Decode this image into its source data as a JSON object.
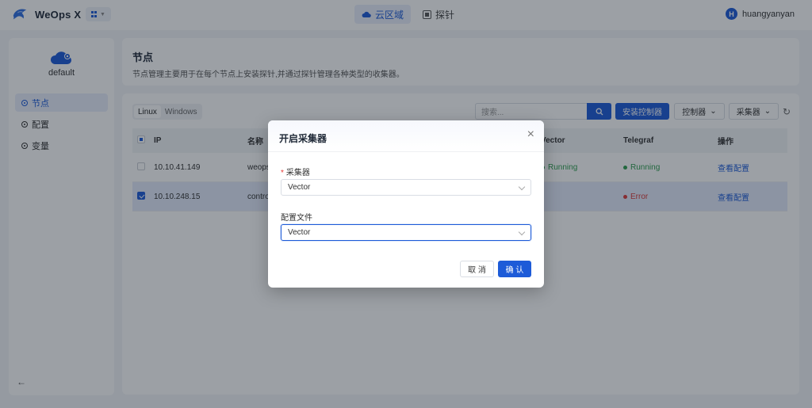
{
  "colors": {
    "primary": "#1d5bd8",
    "running": "#2e9e4f",
    "error": "#d93a3a"
  },
  "brand": {
    "name": "WeOps X"
  },
  "nav": [
    {
      "label": "云区域",
      "icon": "cloud-icon"
    },
    {
      "label": "探针",
      "icon": "probe-icon"
    }
  ],
  "user": {
    "initial": "H",
    "name": "huangyanyan"
  },
  "sidebar": {
    "cloud_label": "default",
    "items": [
      {
        "label": "节点"
      },
      {
        "label": "配置"
      },
      {
        "label": "变量"
      }
    ]
  },
  "header": {
    "title": "节点",
    "description": "节点管理主要用于在每个节点上安装探针,并通过探针管理各种类型的收集器。"
  },
  "toolbar": {
    "os_tabs": [
      "Linux",
      "Windows"
    ],
    "search_placeholder": "搜索...",
    "install_label": "安装控制器",
    "controller_label": "控制器",
    "collector_label": "采集器"
  },
  "table": {
    "columns": {
      "ip": "IP",
      "name": "名称",
      "vector": "Vector",
      "telegraf": "Telegraf",
      "ops": "操作"
    },
    "rows": [
      {
        "ip": "10.10.41.149",
        "name": "weops",
        "vector": "Running",
        "telegraf": "Running",
        "op": "查看配置"
      },
      {
        "ip": "10.10.248.15",
        "name": "control",
        "vector": "",
        "telegraf": "Error",
        "op": "查看配置"
      }
    ]
  },
  "modal": {
    "title": "开启采集器",
    "collector_label": "采集器",
    "collector_value": "Vector",
    "config_label": "配置文件",
    "config_value": "Vector",
    "cancel_label": "取 消",
    "ok_label": "确 认"
  }
}
